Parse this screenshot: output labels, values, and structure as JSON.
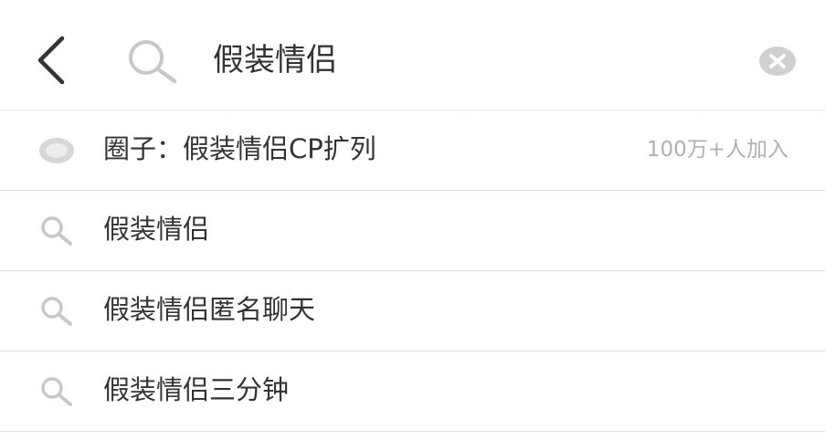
{
  "search": {
    "query": "假装情侣",
    "back_icon": "chevron-left-icon",
    "search_icon": "search-icon",
    "clear_icon": "clear-circle-x-icon"
  },
  "circle_suggestion": {
    "label": "圈子：假装情侣CP扩列",
    "members": "100万+人加入",
    "icon": "circle-icon"
  },
  "suggestions": [
    {
      "label": "假装情侣",
      "icon": "search-icon"
    },
    {
      "label": "假装情侣匿名聊天",
      "icon": "search-icon"
    },
    {
      "label": "假装情侣三分钟",
      "icon": "search-icon"
    }
  ],
  "colors": {
    "text": "#333333",
    "muted": "#b0b0b0",
    "icon_gray": "#c8c8c8",
    "divider": "#dcdcdc"
  }
}
